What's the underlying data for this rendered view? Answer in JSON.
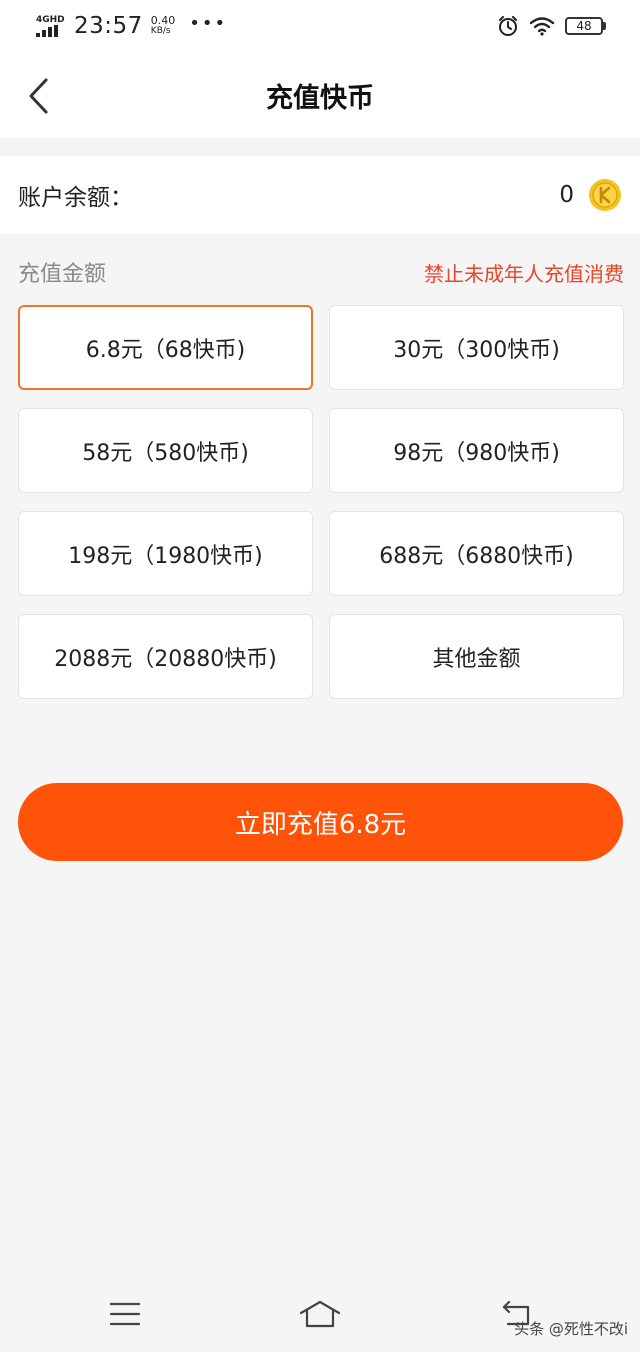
{
  "status_bar": {
    "network": "4GHD",
    "time": "23:57",
    "speed_value": "0.40",
    "speed_unit": "KB/s",
    "more": "•••",
    "battery": "48"
  },
  "nav": {
    "title": "充值快币"
  },
  "balance": {
    "label": "账户余额：",
    "value": "0"
  },
  "section": {
    "title": "充值金额",
    "warning": "禁止未成年人充值消费"
  },
  "options": [
    {
      "label": "6.8元（68快币)",
      "selected": true
    },
    {
      "label": "30元（300快币)",
      "selected": false
    },
    {
      "label": "58元（580快币)",
      "selected": false
    },
    {
      "label": "98元（980快币)",
      "selected": false
    },
    {
      "label": "198元（1980快币)",
      "selected": false
    },
    {
      "label": "688元（6880快币)",
      "selected": false
    },
    {
      "label": "2088元（20880快币)",
      "selected": false
    },
    {
      "label": "其他金额",
      "selected": false
    }
  ],
  "pay_button": {
    "label": "立即充值6.8元"
  },
  "watermark": {
    "text": "头条 @死性不改i"
  },
  "colors": {
    "accent": "#ff5309",
    "selected_border": "#f0752a",
    "warning": "#e6452e"
  }
}
